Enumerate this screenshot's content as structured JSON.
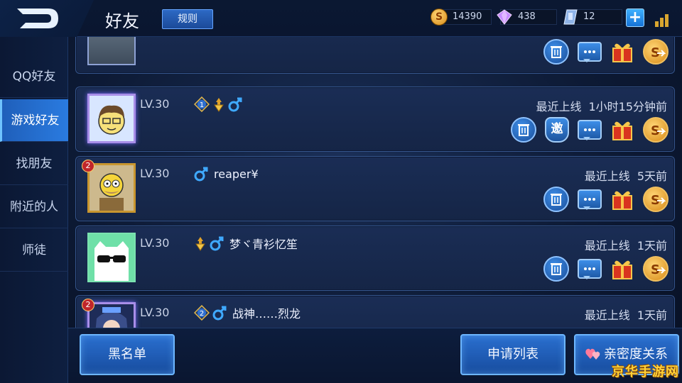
{
  "header": {
    "title": "好友",
    "rules_label": "规则",
    "gold": "14390",
    "diamonds": "438",
    "vouchers": "12",
    "add_label": "+"
  },
  "sidebar": {
    "items": [
      {
        "label": "QQ好友",
        "active": false
      },
      {
        "label": "游戏好友",
        "active": true
      },
      {
        "label": "找朋友",
        "active": false
      },
      {
        "label": "附近的人",
        "active": false
      },
      {
        "label": "师徒",
        "active": false
      }
    ]
  },
  "friends": [
    {
      "level": "",
      "nickname": "",
      "online_label": "",
      "online_time": ""
    },
    {
      "level": "LV.30",
      "rank_num": "1",
      "nickname": "",
      "online_label": "最近上线",
      "online_time": "1小时15分钟前",
      "invite": "邀"
    },
    {
      "level": "LV.30",
      "nickname": "reaper¥",
      "online_label": "最近上线",
      "online_time": "5天前",
      "badge": "2"
    },
    {
      "level": "LV.30",
      "nickname": "梦ヾ青衫忆笙",
      "online_label": "最近上线",
      "online_time": "1天前"
    },
    {
      "level": "LV.30",
      "rank_num": "2",
      "nickname": "战神……烈龙",
      "online_label": "最近上线",
      "online_time": "1天前",
      "badge": "2"
    }
  ],
  "bottom": {
    "blacklist_label": "黑名单",
    "requests_label": "申请列表",
    "intimacy_label": "亲密度关系"
  },
  "watermark": "京华手游网",
  "colors": {
    "accent_blue": "#2a7be0",
    "gold": "#d9a630",
    "card_border": "#35558c"
  }
}
